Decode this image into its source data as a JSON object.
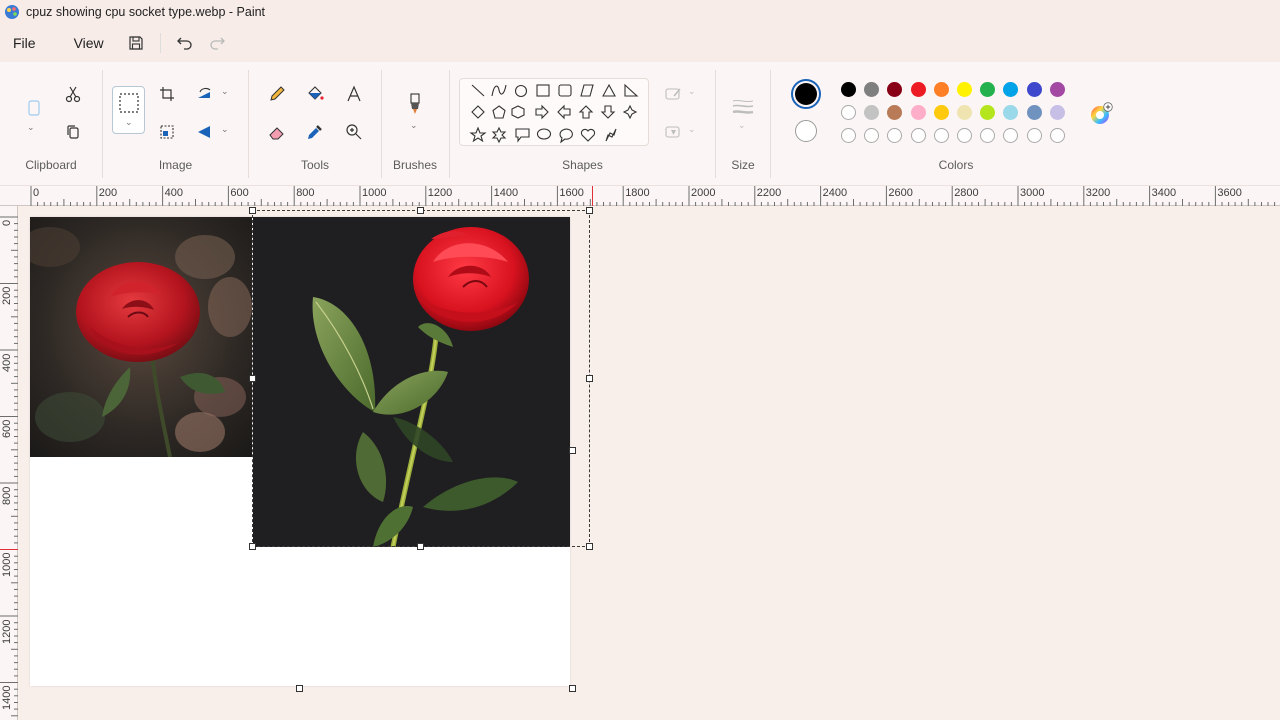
{
  "window": {
    "title": "cpuz showing cpu socket type.webp - Paint"
  },
  "menu": {
    "file": "File",
    "view": "View"
  },
  "quick_access": {
    "save_icon": "save-icon",
    "undo_icon": "undo-icon",
    "redo_icon": "redo-icon"
  },
  "ribbon": {
    "groups": {
      "clipboard": "Clipboard",
      "image": "Image",
      "tools": "Tools",
      "brushes": "Brushes",
      "shapes": "Shapes",
      "size": "Size",
      "colors": "Colors"
    }
  },
  "colors": {
    "primary": "#000000",
    "secondary": "#ffffff",
    "row1": [
      "#000000",
      "#7f7f7f",
      "#880015",
      "#ed1c24",
      "#ff7f27",
      "#fff200",
      "#22b14c",
      "#00a2e8",
      "#3f48cc",
      "#a349a4"
    ],
    "row2": [
      "#ffffff",
      "#c3c3c3",
      "#b97a57",
      "#ffaec9",
      "#ffc90e",
      "#efe4b0",
      "#b5e61d",
      "#99d9ea",
      "#7092be",
      "#c8bfe7"
    ],
    "row3_empty_slots": 10
  },
  "ruler": {
    "horizontal_labels": [
      "0",
      "200",
      "400",
      "600",
      "800",
      "1000",
      "1200",
      "1400",
      "1600",
      "1800",
      "2000",
      "2200",
      "2400",
      "2600",
      "2800",
      "3000",
      "3200",
      "3400",
      "3600"
    ],
    "vertical_labels": [
      "0",
      "200",
      "400",
      "600",
      "800",
      "1000",
      "1200",
      "1400"
    ]
  }
}
